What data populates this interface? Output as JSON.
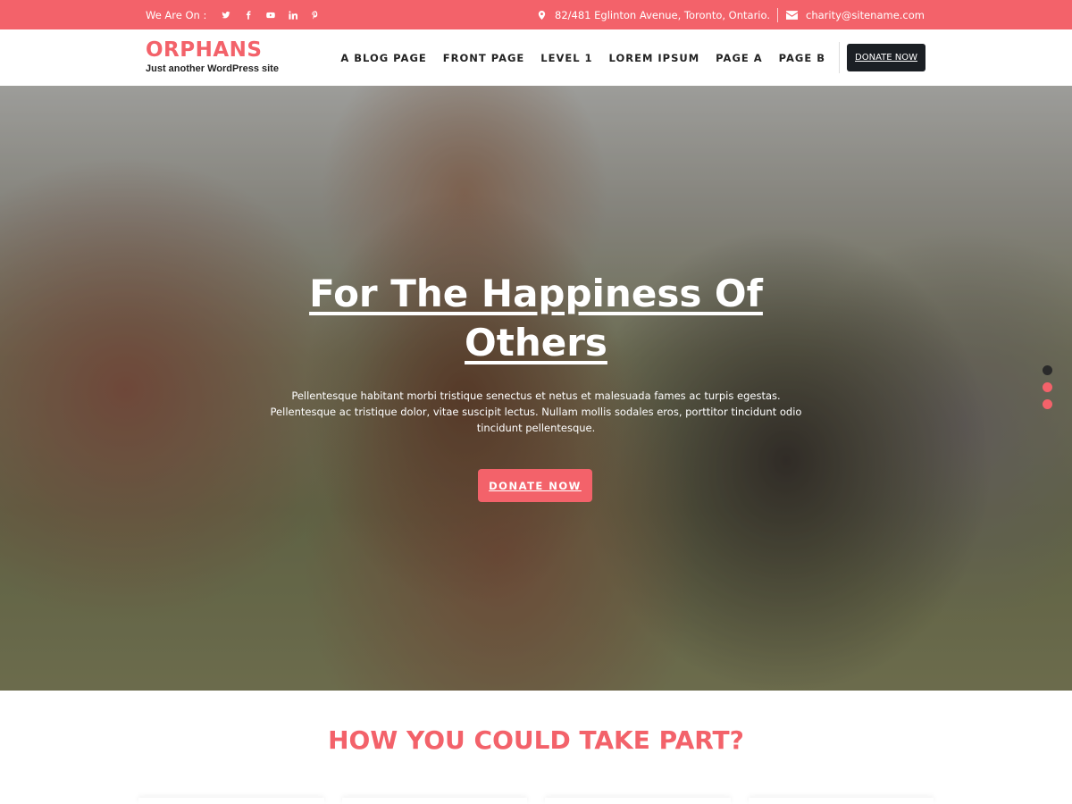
{
  "topbar": {
    "label": "We Are On :",
    "social": [
      "twitter-icon",
      "facebook-icon",
      "youtube-icon",
      "linkedin-icon",
      "pinterest-icon"
    ],
    "address": "82/481 Eglinton Avenue, Toronto, Ontario.",
    "email": "charity@sitename.com",
    "bg_color": "#f3626a"
  },
  "header": {
    "site_title": "ORPHANS",
    "tagline": "Just another WordPress site",
    "nav": [
      "A BLOG PAGE",
      "FRONT PAGE",
      "LEVEL 1",
      "LOREM IPSUM",
      "PAGE A",
      "PAGE B"
    ],
    "donate_label": "DONATE NOW"
  },
  "hero": {
    "title": "For The Happiness Of Others",
    "text": "Pellentesque habitant morbi tristique senectus et netus et malesuada fames ac turpis egestas. Pellentesque ac tristique dolor, vitae suscipit lectus. Nullam mollis sodales eros, porttitor tincidunt odio tincidunt pellentesque.",
    "button_label": "DONATE NOW",
    "slide_count": 3,
    "active_slide": 1
  },
  "section": {
    "title": "HOW YOU COULD TAKE PART?"
  },
  "colors": {
    "accent": "#f3626a",
    "dark_button": "#1b1f24"
  }
}
